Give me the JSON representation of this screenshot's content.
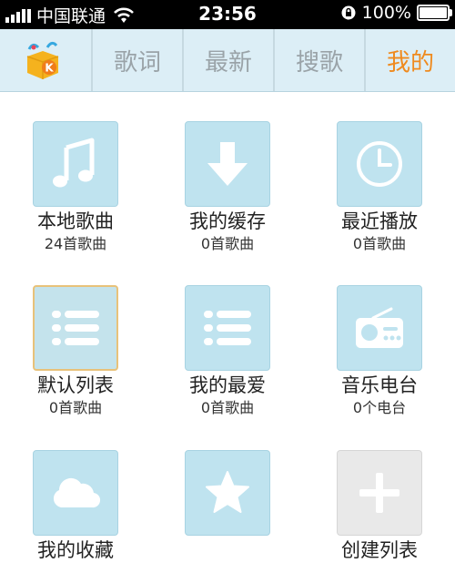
{
  "status_bar": {
    "carrier": "中国联通",
    "time": "23:56",
    "battery": "100%",
    "battery_level": 1.0
  },
  "header": {
    "logo_icon": "kugou-logo-icon",
    "tabs": [
      {
        "label": "歌词",
        "active": false
      },
      {
        "label": "最新",
        "active": false
      },
      {
        "label": "搜歌",
        "active": false
      },
      {
        "label": "我的",
        "active": true
      }
    ]
  },
  "colors": {
    "accent": "#ef8a1e",
    "tile_bg": "#bfe3ef",
    "header_bg": "#dceef6"
  },
  "tiles": [
    {
      "icon": "music-note-icon",
      "name": "本地歌曲",
      "count": "24首歌曲"
    },
    {
      "icon": "download-arrow-icon",
      "name": "我的缓存",
      "count": "0首歌曲"
    },
    {
      "icon": "clock-icon",
      "name": "最近播放",
      "count": "0首歌曲"
    },
    {
      "icon": "list-icon",
      "name": "默认列表",
      "count": "0首歌曲"
    },
    {
      "icon": "list-icon",
      "name": "我的最爱",
      "count": "0首歌曲"
    },
    {
      "icon": "radio-icon",
      "name": "音乐电台",
      "count": "0个电台"
    },
    {
      "icon": "cloud-icon",
      "name": "我的收藏",
      "count": ""
    },
    {
      "icon": "star-icon",
      "name": "",
      "count": ""
    },
    {
      "icon": "plus-icon",
      "name": "创建列表",
      "count": ""
    }
  ]
}
